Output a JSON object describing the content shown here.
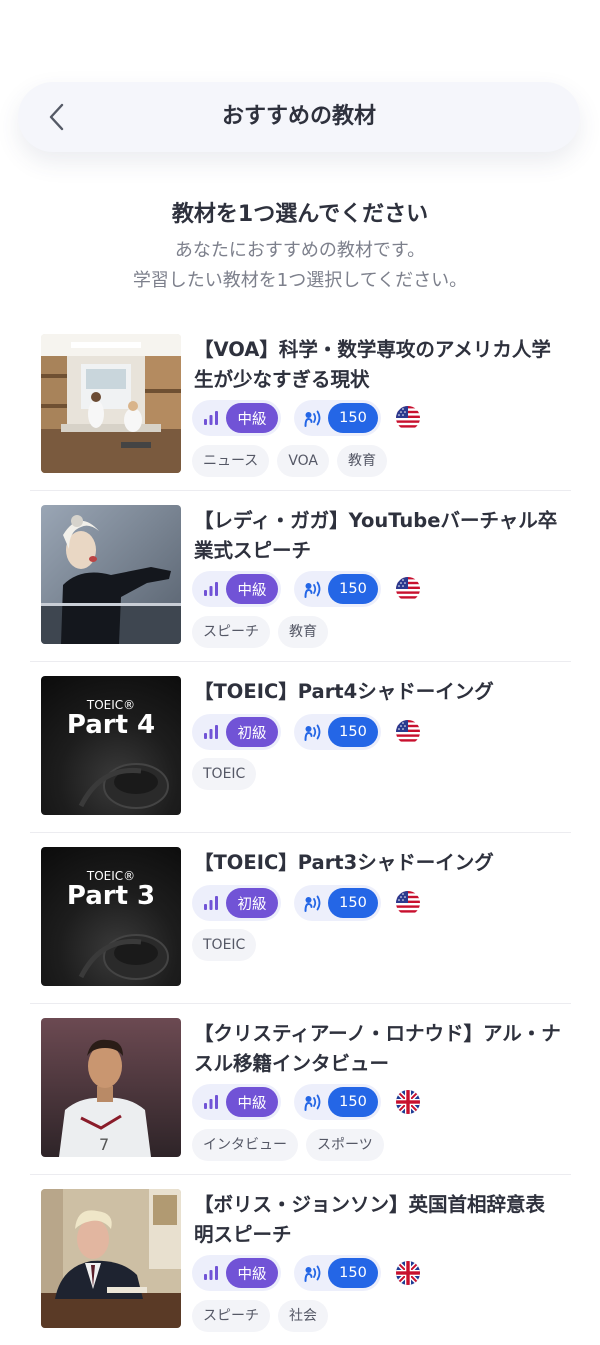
{
  "header": {
    "title": "おすすめの教材",
    "back_icon": "chevron-left-icon"
  },
  "intro": {
    "title": "教材を1つ選んでください",
    "subtitle_line1": "あなたにおすすめの教材です。",
    "subtitle_line2": "学習したい教材を1つ選択してください。"
  },
  "icons": {
    "level": "signal-bars-icon",
    "shadowing": "speaking-icon"
  },
  "colors": {
    "level_pill": "#7153d6",
    "count_pill": "#2466e6",
    "badge_bg": "#edeffb"
  },
  "materials": [
    {
      "title": "【VOA】科学・数学専攻のアメリカ人学生が少なすぎる現状",
      "level": "中級",
      "count": "150",
      "flag": "us-flag",
      "tags": [
        "ニュース",
        "VOA",
        "教育"
      ]
    },
    {
      "title": "【レディ・ガガ】YouTubeバーチャル卒業式スピーチ",
      "level": "中級",
      "count": "150",
      "flag": "us-flag",
      "tags": [
        "スピーチ",
        "教育"
      ]
    },
    {
      "title": "【TOEIC】Part4シャドーイング",
      "level": "初級",
      "count": "150",
      "flag": "us-flag",
      "tags": [
        "TOEIC"
      ],
      "thumb_brand": "TOEIC®",
      "thumb_text": "Part 4"
    },
    {
      "title": "【TOEIC】Part3シャドーイング",
      "level": "初級",
      "count": "150",
      "flag": "us-flag",
      "tags": [
        "TOEIC"
      ],
      "thumb_brand": "TOEIC®",
      "thumb_text": "Part 3"
    },
    {
      "title": "【クリスティアーノ・ロナウド】アル・ナスル移籍インタビュー",
      "level": "中級",
      "count": "150",
      "flag": "uk-flag",
      "tags": [
        "インタビュー",
        "スポーツ"
      ]
    },
    {
      "title": "【ボリス・ジョンソン】英国首相辞意表明スピーチ",
      "level": "中級",
      "count": "150",
      "flag": "uk-flag",
      "tags": [
        "スピーチ",
        "社会"
      ]
    }
  ]
}
